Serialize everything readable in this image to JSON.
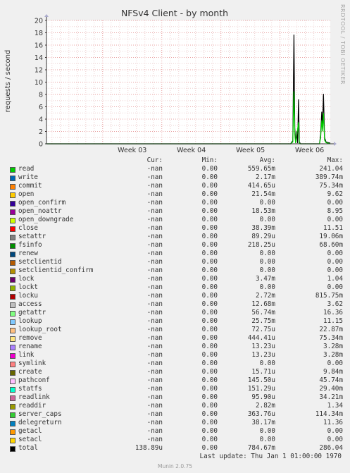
{
  "chart_data": {
    "type": "line",
    "title": "NFSv4 Client - by month",
    "ylabel": "requests / second",
    "ylim": [
      0,
      20
    ],
    "y_ticks": [
      "0",
      "2",
      "4",
      "6",
      "8",
      "10",
      "12",
      "14",
      "16",
      "18",
      "20"
    ],
    "x_ticks": [
      "Week 03",
      "Week 04",
      "Week 05",
      "Week 06"
    ],
    "grid": true,
    "side_label": "RRDTOOL / TOBI OETIKER",
    "series": [
      {
        "name": "total",
        "color": "#000000",
        "points": [
          [
            0.0,
            0
          ],
          [
            0.86,
            0
          ],
          [
            0.868,
            0.5
          ],
          [
            0.872,
            17.7
          ],
          [
            0.875,
            2.6
          ],
          [
            0.878,
            0.2
          ],
          [
            0.882,
            2.0
          ],
          [
            0.885,
            0.1
          ],
          [
            0.888,
            7.2
          ],
          [
            0.891,
            0.3
          ],
          [
            0.895,
            0
          ],
          [
            0.962,
            0
          ],
          [
            0.966,
            1.5
          ],
          [
            0.97,
            5.2
          ],
          [
            0.973,
            3.0
          ],
          [
            0.976,
            8.1
          ],
          [
            0.98,
            1.0
          ],
          [
            0.985,
            0.3
          ],
          [
            1.0,
            0.1
          ]
        ]
      },
      {
        "name": "read",
        "color": "#00cc00",
        "points": [
          [
            0.0,
            0
          ],
          [
            0.86,
            0
          ],
          [
            0.868,
            0.3
          ],
          [
            0.872,
            8.5
          ],
          [
            0.875,
            1.5
          ],
          [
            0.878,
            0.1
          ],
          [
            0.888,
            3.5
          ],
          [
            0.891,
            0.1
          ],
          [
            0.895,
            0
          ],
          [
            0.962,
            0
          ],
          [
            0.966,
            1.0
          ],
          [
            0.97,
            3.8
          ],
          [
            0.973,
            2.0
          ],
          [
            0.976,
            5.0
          ],
          [
            0.98,
            0.6
          ],
          [
            0.985,
            0.2
          ],
          [
            1.0,
            0
          ]
        ]
      }
    ]
  },
  "legend_header": {
    "cur": "Cur:",
    "min": "Min:",
    "avg": "Avg:",
    "max": "Max:"
  },
  "legend": [
    {
      "name": "read",
      "color": "#00cc00",
      "cur": "-nan",
      "min": "0.00",
      "avg": "559.65m",
      "max": "241.04"
    },
    {
      "name": "write",
      "color": "#0066b3",
      "cur": "-nan",
      "min": "0.00",
      "avg": "2.17m",
      "max": "389.74m"
    },
    {
      "name": "commit",
      "color": "#ff8000",
      "cur": "-nan",
      "min": "0.00",
      "avg": "414.65u",
      "max": "75.34m"
    },
    {
      "name": "open",
      "color": "#ffcc00",
      "cur": "-nan",
      "min": "0.00",
      "avg": "21.54m",
      "max": "9.62"
    },
    {
      "name": "open_confirm",
      "color": "#330099",
      "cur": "-nan",
      "min": "0.00",
      "avg": "0.00",
      "max": "0.00"
    },
    {
      "name": "open_noattr",
      "color": "#990099",
      "cur": "-nan",
      "min": "0.00",
      "avg": "18.53m",
      "max": "8.95"
    },
    {
      "name": "open_downgrade",
      "color": "#ccff00",
      "cur": "-nan",
      "min": "0.00",
      "avg": "0.00",
      "max": "0.00"
    },
    {
      "name": "close",
      "color": "#ff0000",
      "cur": "-nan",
      "min": "0.00",
      "avg": "38.39m",
      "max": "11.51"
    },
    {
      "name": "setattr",
      "color": "#808080",
      "cur": "-nan",
      "min": "0.00",
      "avg": "89.29u",
      "max": "19.06m"
    },
    {
      "name": "fsinfo",
      "color": "#008f00",
      "cur": "-nan",
      "min": "0.00",
      "avg": "218.25u",
      "max": "68.60m"
    },
    {
      "name": "renew",
      "color": "#00487d",
      "cur": "-nan",
      "min": "0.00",
      "avg": "0.00",
      "max": "0.00"
    },
    {
      "name": "setclientid",
      "color": "#b35a00",
      "cur": "-nan",
      "min": "0.00",
      "avg": "0.00",
      "max": "0.00"
    },
    {
      "name": "setclientid_confirm",
      "color": "#b38f00",
      "cur": "-nan",
      "min": "0.00",
      "avg": "0.00",
      "max": "0.00"
    },
    {
      "name": "lock",
      "color": "#6b006b",
      "cur": "-nan",
      "min": "0.00",
      "avg": "3.47m",
      "max": "1.04"
    },
    {
      "name": "lockt",
      "color": "#8fb300",
      "cur": "-nan",
      "min": "0.00",
      "avg": "0.00",
      "max": "0.00"
    },
    {
      "name": "locku",
      "color": "#b30000",
      "cur": "-nan",
      "min": "0.00",
      "avg": "2.72m",
      "max": "815.75m"
    },
    {
      "name": "access",
      "color": "#bebebe",
      "cur": "-nan",
      "min": "0.00",
      "avg": "12.68m",
      "max": "3.62"
    },
    {
      "name": "getattr",
      "color": "#80ff80",
      "cur": "-nan",
      "min": "0.00",
      "avg": "56.74m",
      "max": "16.36"
    },
    {
      "name": "lookup",
      "color": "#80c9ff",
      "cur": "-nan",
      "min": "0.00",
      "avg": "25.75m",
      "max": "11.15"
    },
    {
      "name": "lookup_root",
      "color": "#ffc080",
      "cur": "-nan",
      "min": "0.00",
      "avg": "72.75u",
      "max": "22.87m"
    },
    {
      "name": "remove",
      "color": "#ffe680",
      "cur": "-nan",
      "min": "0.00",
      "avg": "444.41u",
      "max": "75.34m"
    },
    {
      "name": "rename",
      "color": "#aa80ff",
      "cur": "-nan",
      "min": "0.00",
      "avg": "13.23u",
      "max": "3.28m"
    },
    {
      "name": "link",
      "color": "#ee00cc",
      "cur": "-nan",
      "min": "0.00",
      "avg": "13.23u",
      "max": "3.28m"
    },
    {
      "name": "symlink",
      "color": "#ff8080",
      "cur": "-nan",
      "min": "0.00",
      "avg": "0.00",
      "max": "0.00"
    },
    {
      "name": "create",
      "color": "#666600",
      "cur": "-nan",
      "min": "0.00",
      "avg": "15.71u",
      "max": "9.84m"
    },
    {
      "name": "pathconf",
      "color": "#ffbfff",
      "cur": "-nan",
      "min": "0.00",
      "avg": "145.50u",
      "max": "45.74m"
    },
    {
      "name": "statfs",
      "color": "#00ffcc",
      "cur": "-nan",
      "min": "0.00",
      "avg": "151.29u",
      "max": "29.40m"
    },
    {
      "name": "readlink",
      "color": "#cc6699",
      "cur": "-nan",
      "min": "0.00",
      "avg": "95.90u",
      "max": "34.21m"
    },
    {
      "name": "readdir",
      "color": "#999900",
      "cur": "-nan",
      "min": "0.00",
      "avg": "2.82m",
      "max": "1.34"
    },
    {
      "name": "server_caps",
      "color": "#33cc33",
      "cur": "-nan",
      "min": "0.00",
      "avg": "363.76u",
      "max": "114.34m"
    },
    {
      "name": "delegreturn",
      "color": "#0080c0",
      "cur": "-nan",
      "min": "0.00",
      "avg": "38.17m",
      "max": "11.36"
    },
    {
      "name": "getacl",
      "color": "#ff9900",
      "cur": "-nan",
      "min": "0.00",
      "avg": "0.00",
      "max": "0.00"
    },
    {
      "name": "setacl",
      "color": "#ffd500",
      "cur": "-nan",
      "min": "0.00",
      "avg": "0.00",
      "max": "0.00"
    },
    {
      "name": "total",
      "color": "#000000",
      "cur": "138.89u",
      "min": "0.00",
      "avg": "784.67m",
      "max": "286.04"
    }
  ],
  "last_update": "Last update: Thu Jan  1 01:00:00 1970",
  "version": "Munin 2.0.75"
}
